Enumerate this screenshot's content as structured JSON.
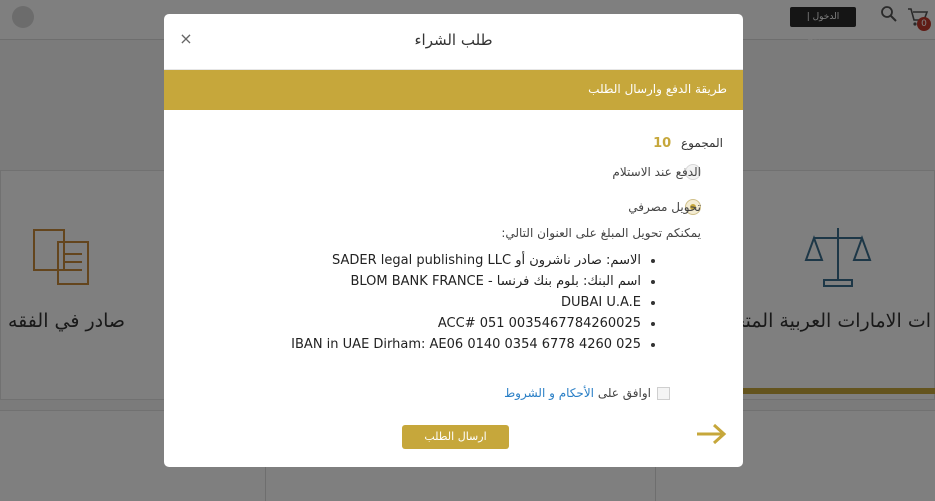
{
  "background": {
    "login_button": "الدخول | التسجيل",
    "cart_count": "0",
    "card_left_title": "صادر في الفقه",
    "card_right_title": "ات الامارات العربية المتحدة"
  },
  "modal": {
    "title": "طلب الشراء",
    "close_symbol": "×",
    "section_title": "طريقة الدفع وارسال الطلب",
    "total_label": "المجموع",
    "total_value": "10",
    "payment_options": [
      {
        "label": "الدفع عند الاستلام",
        "selected": false
      },
      {
        "label": "تحويل مصرفي",
        "selected": true
      }
    ],
    "transfer_note": "يمكنكم تحويل المبلغ على العنوان التالي:",
    "bank_details": [
      "الاسم: صادر ناشرون أو SADER legal publishing LLC",
      "اسم البنك: بلوم بنك فرنسا - BLOM BANK FRANCE",
      "DUBAI U.A.E",
      "ACC# 051 0035467784260025",
      "IBAN in UAE Dirham: AE06 0140 0354 6778 4260 025"
    ],
    "terms_prefix": "اوافق على ",
    "terms_link": "الأحكام و الشروط",
    "submit_label": "ارسال الطلب"
  },
  "colors": {
    "accent_gold": "#c6a73b",
    "link_blue": "#2a7fc6",
    "overlay": "rgba(0,0,0,0.5)"
  },
  "icons": {
    "close": "close-icon",
    "arrow": "arrow-right-icon",
    "search": "search-icon",
    "cart": "cart-icon"
  }
}
